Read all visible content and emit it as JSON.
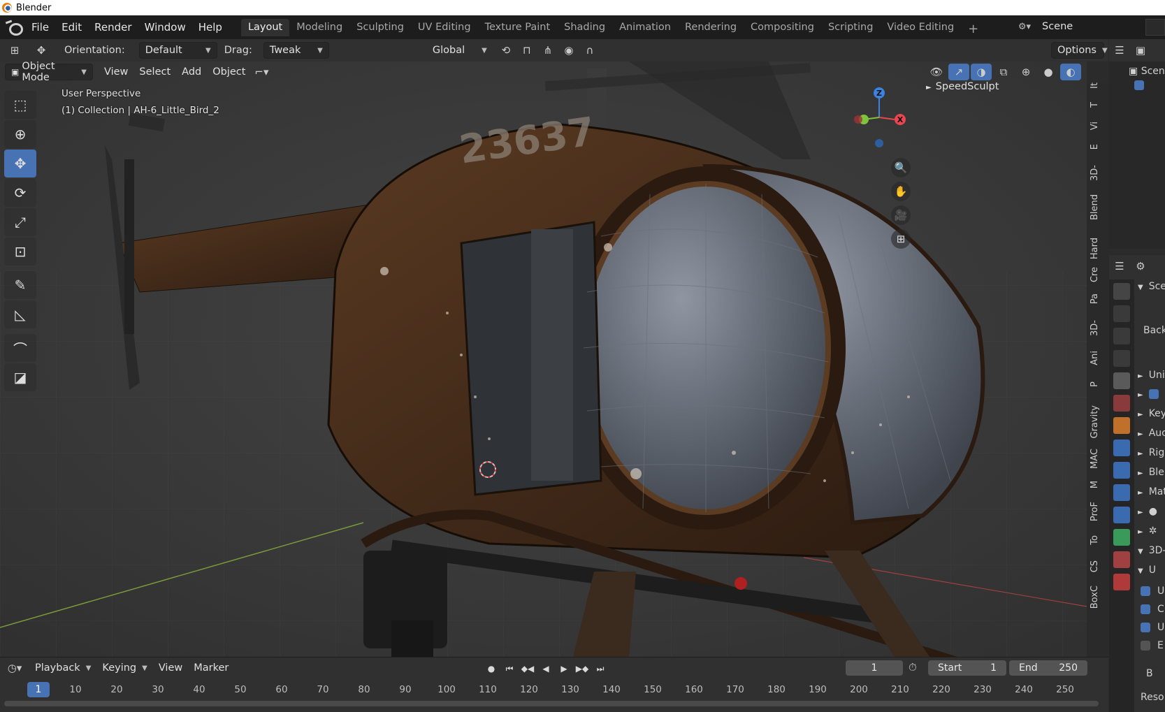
{
  "window": {
    "title": "Blender"
  },
  "menubar": {
    "items": [
      "File",
      "Edit",
      "Render",
      "Window",
      "Help"
    ],
    "workspaces": [
      "Layout",
      "Modeling",
      "Sculpting",
      "UV Editing",
      "Texture Paint",
      "Shading",
      "Animation",
      "Rendering",
      "Compositing",
      "Scripting",
      "Video Editing"
    ],
    "active_workspace": "Layout",
    "add_tab": "+",
    "scene_name": "Scene"
  },
  "tool_header": {
    "orientation_label": "Orientation:",
    "orientation_value": "Default",
    "drag_label": "Drag:",
    "drag_value": "Tweak",
    "transform_orientation": "Global",
    "options_label": "Options"
  },
  "viewport_header": {
    "mode": "Object Mode",
    "menus": [
      "View",
      "Select",
      "Add",
      "Object"
    ]
  },
  "viewport": {
    "perspective_label": "User Perspective",
    "collection_label": "(1) Collection | AH-6_Little_Bird_2",
    "speedsculpt_label": "SpeedSculpt",
    "tail_number": "23637",
    "gizmo_axes": {
      "z": "Z",
      "x": "X"
    }
  },
  "side_tabs": [
    "It",
    "T",
    "Vi",
    "E",
    "3D-",
    "Blend",
    "Hard",
    "Cre",
    "Pa",
    "3D-",
    "Ani",
    "P",
    "Gravity",
    "MAC",
    "M",
    "ProF",
    "To",
    "CS",
    "BoxC"
  ],
  "outliner": {
    "row1": "Scen"
  },
  "properties": {
    "rows": [
      {
        "text": "Sce",
        "arrow": "▼"
      },
      {
        "text": "Backg",
        "arrow": ""
      },
      {
        "text": "Uni",
        "arrow": "►"
      },
      {
        "text": "",
        "arrow": "►",
        "checkbox": true
      },
      {
        "text": "Key",
        "arrow": "►"
      },
      {
        "text": "Auc",
        "arrow": "►"
      },
      {
        "text": "Rig",
        "arrow": "►"
      },
      {
        "text": "Blei",
        "arrow": "►"
      },
      {
        "text": "Mat",
        "arrow": "►"
      },
      {
        "text": "●",
        "arrow": "►"
      },
      {
        "text": "✲",
        "arrow": "►"
      },
      {
        "text": "3D-",
        "arrow": "▼"
      },
      {
        "text": "U",
        "arrow": "▼"
      }
    ],
    "checks": [
      {
        "text": "U",
        "on": true
      },
      {
        "text": "C",
        "on": true
      },
      {
        "text": "U",
        "on": true
      },
      {
        "text": "E",
        "on": false
      }
    ],
    "bottom_rows": [
      "B",
      "Reso"
    ]
  },
  "timeline": {
    "menus": [
      "Playback",
      "Keying",
      "View",
      "Marker"
    ],
    "current_frame": "1",
    "start_label": "Start",
    "start_value": "1",
    "end_label": "End",
    "end_value": "250",
    "ruler_ticks": [
      "1",
      "10",
      "20",
      "30",
      "40",
      "50",
      "60",
      "70",
      "80",
      "90",
      "100",
      "110",
      "120",
      "130",
      "140",
      "150",
      "160",
      "170",
      "180",
      "190",
      "200",
      "210",
      "220",
      "230",
      "240",
      "250"
    ]
  },
  "colors": {
    "accent": "#4772b3",
    "axis_x": "#e8474f",
    "axis_y": "#7fc23c",
    "axis_z": "#3a83e0",
    "helicopter_body": "#4a2f1c"
  }
}
